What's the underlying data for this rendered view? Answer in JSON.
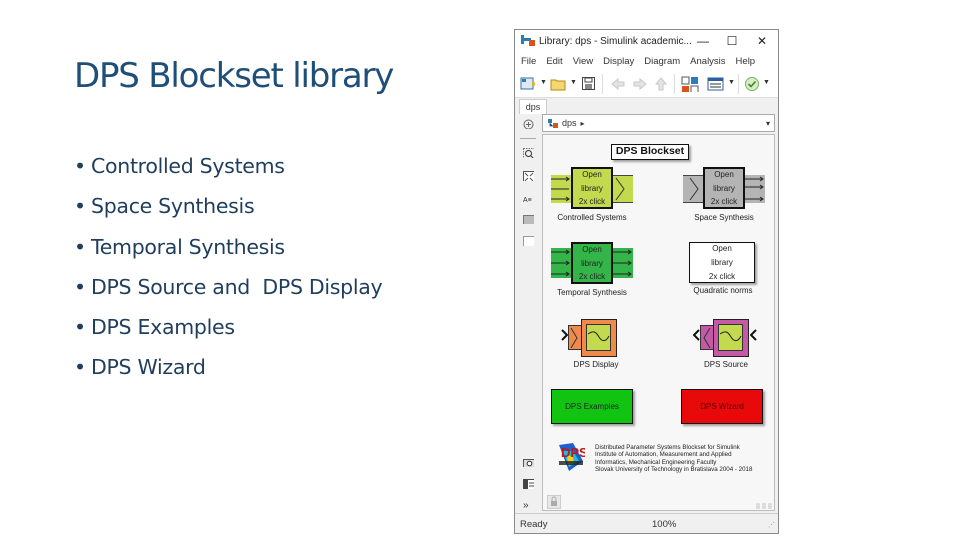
{
  "slide": {
    "title": "DPS Blockset library",
    "bullets": [
      "Controlled Systems",
      "Space Synthesis",
      "Temporal Synthesis",
      "DPS Source and  DPS Display",
      "DPS Examples",
      "DPS Wizard"
    ]
  },
  "window": {
    "title": "Library: dps - Simulink academic...",
    "controls": {
      "minimize": "—",
      "maximize": "☐",
      "close": "✕"
    },
    "menu": [
      "File",
      "Edit",
      "View",
      "Display",
      "Diagram",
      "Analysis",
      "Help"
    ],
    "toolbar_icons": [
      "new-model-icon",
      "open-folder-icon",
      "save-icon",
      "back-arrow-icon",
      "forward-arrow-icon",
      "up-arrow-icon",
      "library-browser-icon",
      "model-config-icon",
      "check-icon"
    ],
    "tab": "dps",
    "address": {
      "path": "dps",
      "arrow": "▸",
      "dropdown": "▾"
    },
    "side_icons": [
      "hide-explorer-icon",
      "zoom-area-icon",
      "fit-view-icon",
      "annotation-icon",
      "image-icon",
      "area-icon",
      "camera-icon",
      "model-browser-icon",
      "more-icon",
      "lock-icon"
    ],
    "status": {
      "state": "Ready",
      "zoom": "100%"
    }
  },
  "diagram": {
    "header": "DPS Blockset",
    "subsystem_lines": [
      "Open",
      "library",
      "2x click"
    ],
    "blocks": [
      {
        "caption": "Controlled Systems",
        "color": "#c3d94e"
      },
      {
        "caption": "Space Synthesis",
        "color": "#b4b4b4"
      },
      {
        "caption": "Temporal Synthesis",
        "color": "#33b54a"
      },
      {
        "caption": "Quadratic norms",
        "color": "#ffffff"
      },
      {
        "caption": "DPS Display",
        "color": "#f08a4b"
      },
      {
        "caption": "DPS Source",
        "color": "#c45aa5"
      }
    ],
    "scope_screen_color": "#c3d94e",
    "buttons": [
      {
        "label": "DPS Examples",
        "color": "#11c411"
      },
      {
        "label": "DPS Wizard",
        "color": "#e80a0a"
      }
    ],
    "logo_text": "DPS",
    "info_lines": [
      "Distributed Parameter Systems Blockset for Simulink",
      "Institute of Automation, Measurement and Applied",
      "Informatics, Mechanical Engineering Faculty",
      "Slovak University of Technology in Bratislava 2004 - 2018"
    ]
  }
}
